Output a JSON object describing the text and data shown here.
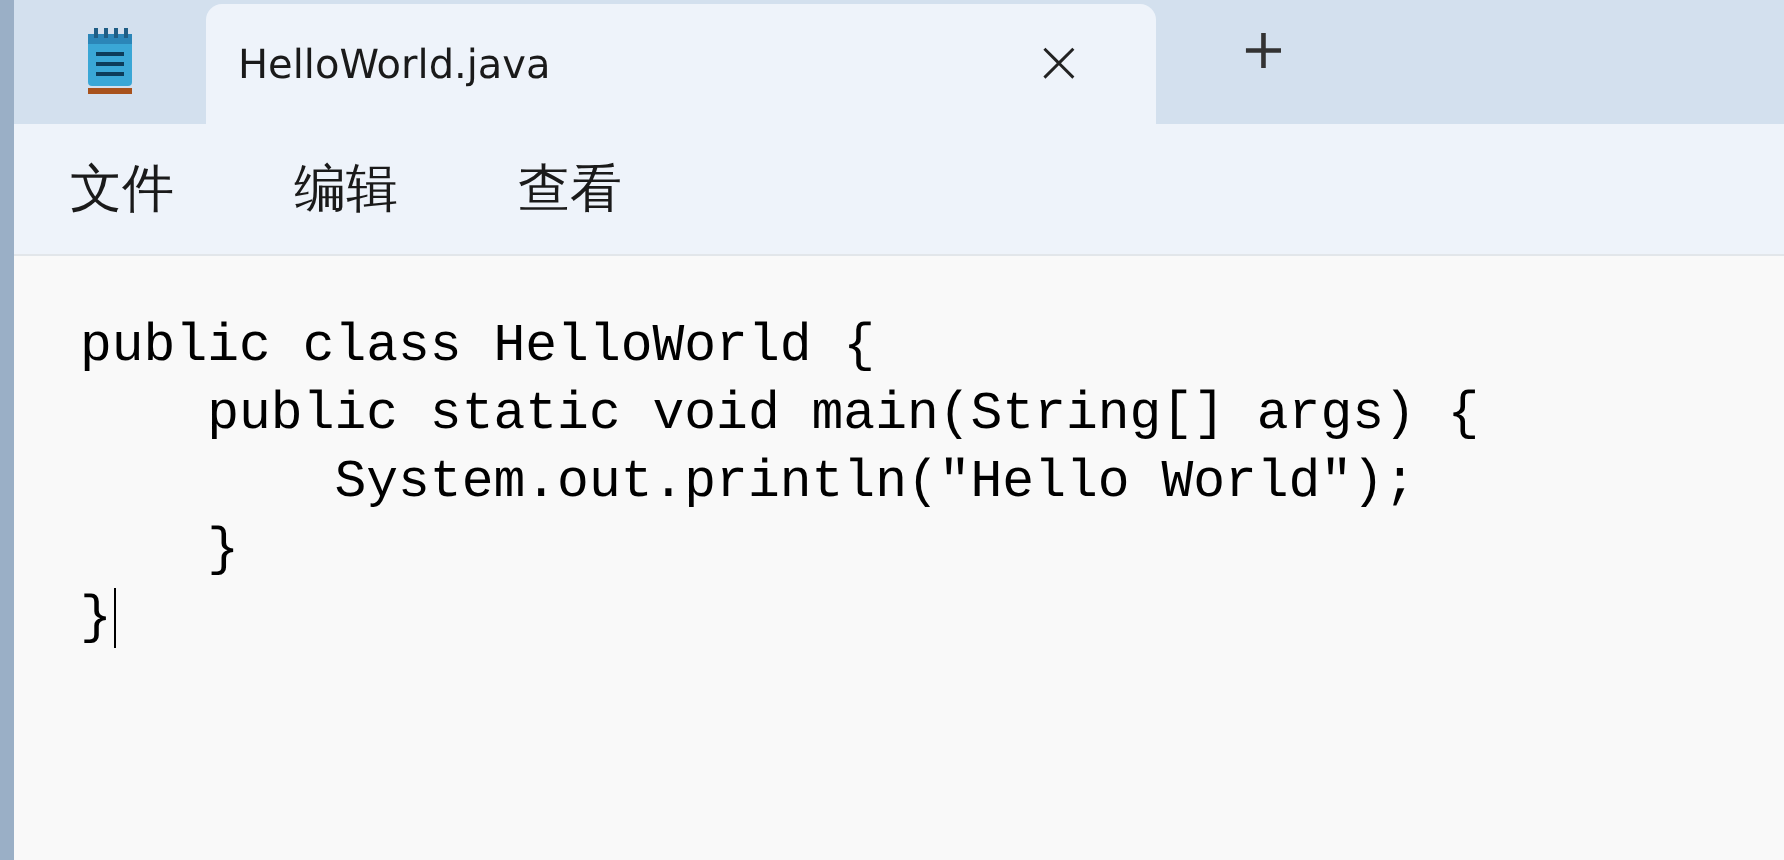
{
  "tabs": [
    {
      "label": "HelloWorld.java",
      "selected": true,
      "close": "×"
    }
  ],
  "new_tab": "+",
  "menu": [
    "文件",
    "编辑",
    "查看"
  ],
  "editor": {
    "lines": [
      {
        "text": "public class HelloWorld {",
        "caret": false
      },
      {
        "text": "    public static void main(String[] args) {",
        "caret": false
      },
      {
        "text": "        System.out.println(\"Hello World\");",
        "caret": false
      },
      {
        "text": "    }",
        "caret": false
      },
      {
        "text": "}",
        "caret": true
      }
    ]
  }
}
